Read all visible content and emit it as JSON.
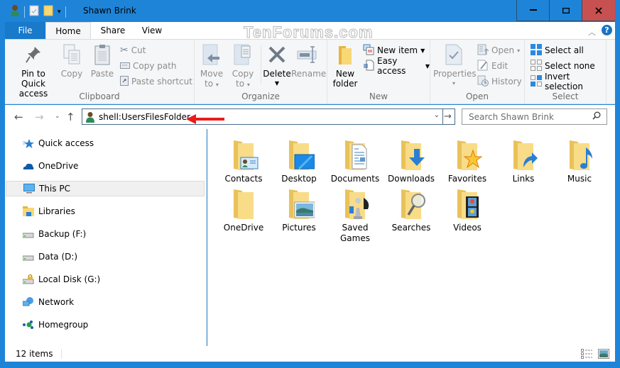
{
  "window": {
    "title": "Shawn Brink",
    "controls": {
      "minimize": "—",
      "maximize": "▢",
      "close": "✕"
    },
    "accent": "#1e84d8",
    "close_color": "#c75050"
  },
  "watermark": "TenForums.com",
  "tabs": [
    {
      "label": "File"
    },
    {
      "label": "Home"
    },
    {
      "label": "Share"
    },
    {
      "label": "View"
    }
  ],
  "ribbon": {
    "clipboard": {
      "label": "Clipboard",
      "pin": "Pin to Quick access",
      "pin_line1": "Pin to Quick",
      "pin_line2": "access",
      "copy": "Copy",
      "paste": "Paste",
      "cut": "Cut",
      "copy_path": "Copy path",
      "paste_shortcut": "Paste shortcut"
    },
    "organize": {
      "label": "Organize",
      "move_to_1": "Move",
      "move_to_2": "to",
      "copy_to_1": "Copy",
      "copy_to_2": "to",
      "delete": "Delete",
      "rename": "Rename"
    },
    "new": {
      "label": "New",
      "new_folder_1": "New",
      "new_folder_2": "folder",
      "new_item": "New item",
      "easy_access": "Easy access"
    },
    "open": {
      "label": "Open",
      "properties": "Properties",
      "open": "Open",
      "edit": "Edit",
      "history": "History"
    },
    "select": {
      "label": "Select",
      "select_all": "Select all",
      "select_none": "Select none",
      "invert": "Invert selection"
    }
  },
  "address": {
    "value": "shell:UsersFilesFolder",
    "search_placeholder": "Search Shawn Brink"
  },
  "nav": [
    {
      "label": "Quick access",
      "icon": "quick-access-star-icon"
    },
    {
      "label": "OneDrive",
      "icon": "onedrive-cloud-icon"
    },
    {
      "label": "This PC",
      "icon": "this-pc-monitor-icon",
      "selected": true
    },
    {
      "label": "Libraries",
      "icon": "libraries-icon"
    },
    {
      "label": "Backup (F:)",
      "icon": "drive-icon"
    },
    {
      "label": "Data (D:)",
      "icon": "drive-icon"
    },
    {
      "label": "Local Disk (G:)",
      "icon": "locked-drive-icon"
    },
    {
      "label": "Network",
      "icon": "network-icon"
    },
    {
      "label": "Homegroup",
      "icon": "homegroup-icon"
    }
  ],
  "items": [
    {
      "label": "Contacts",
      "overlay": "contact-card"
    },
    {
      "label": "Desktop",
      "overlay": "desktop"
    },
    {
      "label": "Documents",
      "overlay": "document"
    },
    {
      "label": "Downloads",
      "overlay": "download-arrow"
    },
    {
      "label": "Favorites",
      "overlay": "star"
    },
    {
      "label": "Links",
      "overlay": "link-arrow"
    },
    {
      "label": "Music",
      "overlay": "music-note"
    },
    {
      "label": "OneDrive",
      "overlay": "none"
    },
    {
      "label": "Pictures",
      "overlay": "picture"
    },
    {
      "label": "Saved Games",
      "line1": "Saved",
      "line2": "Games",
      "overlay": "chess"
    },
    {
      "label": "Searches",
      "overlay": "magnifier"
    },
    {
      "label": "Videos",
      "overlay": "film"
    }
  ],
  "status": {
    "count": "12 items"
  }
}
